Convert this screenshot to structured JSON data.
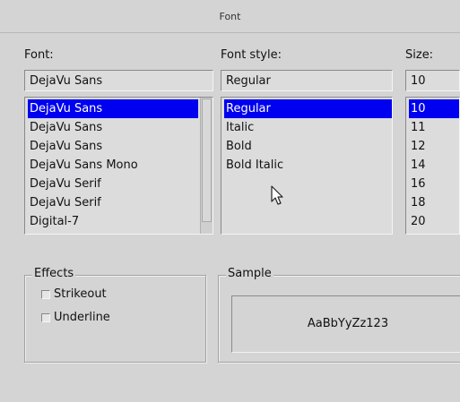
{
  "dialog": {
    "title": "Font",
    "colors": {
      "background": "#d4d4d4",
      "selection": "#0000f0",
      "selection_text": "#ffffff"
    }
  },
  "font": {
    "label": "Font:",
    "entry_value": "DejaVu Sans",
    "items": [
      "DejaVu Sans",
      "DejaVu Sans",
      "DejaVu Sans",
      "DejaVu Sans Mono",
      "DejaVu Serif",
      "DejaVu Serif",
      "Digital-7"
    ],
    "selected_index": 0
  },
  "style": {
    "label": "Font style:",
    "entry_value": "Regular",
    "items": [
      "Regular",
      "Italic",
      "Bold",
      "Bold Italic"
    ],
    "selected_index": 0
  },
  "size": {
    "label": "Size:",
    "entry_value": "10",
    "items": [
      "10",
      "11",
      "12",
      "14",
      "16",
      "18",
      "20"
    ],
    "selected_index": 0
  },
  "effects": {
    "legend": "Effects",
    "strikeout_label": "Strikeout",
    "strikeout_checked": false,
    "underline_label": "Underline",
    "underline_checked": false
  },
  "sample": {
    "legend": "Sample",
    "text": "AaBbYyZz123"
  },
  "cursor": {
    "icon": "arrow-pointer-icon"
  }
}
